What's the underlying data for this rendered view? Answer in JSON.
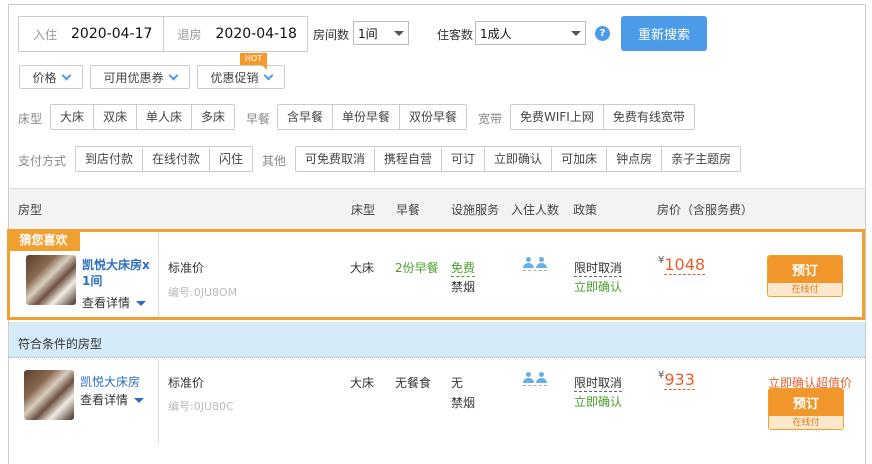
{
  "search": {
    "checkin_label": "入住",
    "checkin_date": "2020-04-17",
    "checkout_label": "退房",
    "checkout_date": "2020-04-18",
    "rooms_label": "房间数",
    "rooms_value": "1间",
    "guests_label": "住客数",
    "guests_value": "1成人",
    "help_icon": "?",
    "search_button": "重新搜索"
  },
  "dropdowns": [
    {
      "label": "价格"
    },
    {
      "label": "可用优惠券"
    },
    {
      "label": "优惠促销",
      "badge": "HOT"
    }
  ],
  "filters": {
    "bed_label": "床型",
    "bed": [
      "大床",
      "双床",
      "单人床",
      "多床"
    ],
    "breakfast_label": "早餐",
    "breakfast": [
      "含早餐",
      "单份早餐",
      "双份早餐"
    ],
    "broadband_label": "宽带",
    "broadband": [
      "免费WIFI上网",
      "免费有线宽带"
    ],
    "payment_label": "支付方式",
    "payment": [
      "到店付款",
      "在线付款",
      "闪住"
    ],
    "other_label": "其他",
    "other": [
      "可免费取消",
      "携程自营",
      "可订",
      "立即确认",
      "可加床",
      "钟点房",
      "亲子主题房"
    ]
  },
  "table_header": [
    "房型",
    "床型",
    "早餐",
    "设施服务",
    "入住人数",
    "政策",
    "房价（含服务费）"
  ],
  "featured": {
    "badge": "猜您喜欢",
    "room_name": "凯悦大床房x 1间",
    "details": "查看详情",
    "rate_name": "标准价",
    "code": "编号:0JU8OM",
    "bed": "大床",
    "breakfast": "2份早餐",
    "facility_1": "免费",
    "facility_2": "禁烟",
    "policy_1": "限时取消",
    "policy_2": "立即确认",
    "currency": "¥",
    "price": "1048",
    "book": "预订",
    "pay": "在线付"
  },
  "section_title": "符合条件的房型",
  "rooms": [
    {
      "room_name": "凯悦大床房",
      "details": "查看详情",
      "rate_name": "标准价",
      "code": "编号:0JU80C",
      "bed": "大床",
      "breakfast": "无餐食",
      "facility_1": "无",
      "facility_2": "禁烟",
      "policy_1": "限时取消",
      "policy_2": "立即确认",
      "currency": "¥",
      "price": "933",
      "promo": "立即确认超值价",
      "book": "预订",
      "pay": "在线付"
    }
  ]
}
